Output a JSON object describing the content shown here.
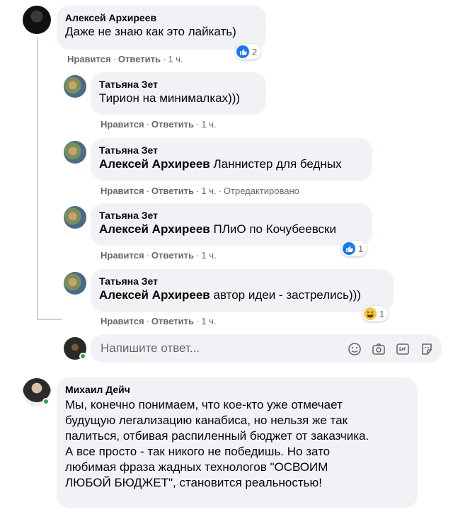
{
  "comments": [
    {
      "author": "Алексей Архиреев",
      "text": "Даже не знаю как это лайкать)",
      "like": "Нравится",
      "reply": "Ответить",
      "time": "1 ч.",
      "reaction_count": "2"
    }
  ],
  "replies": [
    {
      "author": "Татьяна Зет",
      "mention": "",
      "text": "Тирион на минималках)))",
      "like": "Нравится",
      "reply": "Ответить",
      "time": "1 ч."
    },
    {
      "author": "Татьяна Зет",
      "mention": "Алексей Архиреев",
      "text": "Ланнистер для бедных",
      "like": "Нравится",
      "reply": "Ответить",
      "time": "1 ч.",
      "edited": "Отредактировано"
    },
    {
      "author": "Татьяна Зет",
      "mention": "Алексей Архиреев",
      "text": "ПЛиО по Кочубеевски",
      "like": "Нравится",
      "reply": "Ответить",
      "time": "1 ч.",
      "reaction_count": "1"
    },
    {
      "author": "Татьяна Зет",
      "mention": "Алексей Архиреев",
      "text": "автор идеи - застрелись)))",
      "like": "Нравится",
      "reply": "Ответить",
      "time": "1 ч.",
      "reaction_count": "1"
    }
  ],
  "reply_box": {
    "placeholder": "Напишите ответ..."
  },
  "comment2": {
    "author": "Михаил Дейч",
    "lines": [
      "Мы, конечно понимаем, что кое-кто уже отмечает",
      "будущую легализацию канабиса, но нельзя же так",
      "палиться, отбивая распиленный бюджет от заказчика.",
      "А все просто - так никого не победишь. Но зато",
      "любимая фраза жадных технологов \"ОСВОИМ",
      "ЛЮБОЙ БЮДЖЕТ\", становится реальностью!"
    ]
  },
  "colors": {
    "bubble": "#f0f2f5",
    "muted": "#65676b",
    "like": "#1877f2",
    "online": "#31a24c"
  }
}
